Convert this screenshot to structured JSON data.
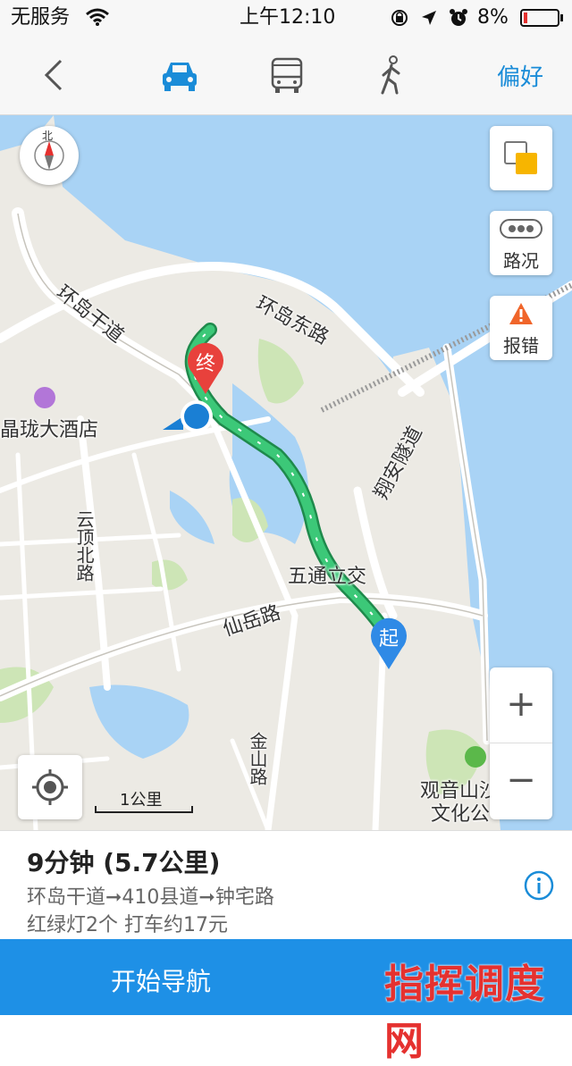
{
  "status_bar": {
    "carrier": "无服务",
    "time": "上午12:10",
    "battery": "8%",
    "icons": [
      "wifi-icon",
      "rotation-lock-icon",
      "location-arrow-icon",
      "alarm-icon",
      "battery-low-icon"
    ]
  },
  "nav": {
    "back_icon": "chevron-left-icon",
    "modes": [
      {
        "icon": "car-icon",
        "active": true
      },
      {
        "icon": "bus-icon",
        "active": false
      },
      {
        "icon": "walk-icon",
        "active": false
      }
    ],
    "preference_label": "偏好"
  },
  "map": {
    "compass_label": "北",
    "labels": {
      "road_huandao_gandao": "环岛干道",
      "road_huandao_donglu": "环岛东路",
      "hotel": "晶珑大酒店",
      "road_yunding_beilu": "云顶北路",
      "tunnel": "翔安隧道",
      "interchange": "五通立交",
      "road_xianyue": "仙岳路",
      "road_jinshan": "金山路",
      "park": "观音山沙",
      "park_line2": "文化公"
    },
    "end_marker": "终",
    "start_marker": "起",
    "scale_label": "1公里",
    "traffic_label": "路况",
    "report_label": "报错",
    "zoom_in": "+",
    "zoom_out": "−",
    "colors": {
      "water": "#a9d3f5",
      "land": "#eceae4",
      "green": "#cde5b6",
      "route": "#3cb371",
      "marker_end": "#e8413c",
      "marker_start": "#2f8ae6"
    }
  },
  "route": {
    "summary": "9分钟 (5.7公里)",
    "path": "环岛干道➞410县道➞钟宅路",
    "extra": "红绿灯2个  打车约17元"
  },
  "start_button": "开始导航",
  "watermark": "指挥调度网"
}
